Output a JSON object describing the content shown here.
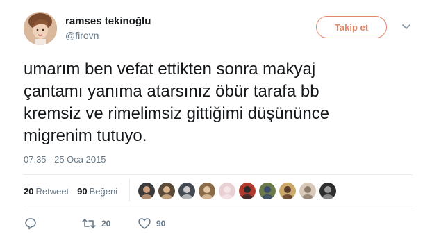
{
  "user": {
    "display_name": "ramses tekinoğlu",
    "username": "@firovn"
  },
  "follow_button_label": "Takip et",
  "tweet": {
    "lines": [
      "umarım ben vefat ettikten sonra makyaj",
      "çantamı yanıma atarsınız öbür tarafa bb",
      "kremsiz ve rimelimsiz gittiğimi düşününce",
      "migrenim tutuyo."
    ],
    "timestamp": "07:35 - 25 Oca 2015"
  },
  "stats": {
    "retweet_count": "20",
    "retweet_label": "Retweet",
    "like_count": "90",
    "like_label": "Beğeni"
  },
  "likers": [
    {
      "color": "#3b3b3b",
      "accent": "#cfa07d"
    },
    {
      "color": "#5a4a3a",
      "accent": "#d9b48c"
    },
    {
      "color": "#444a52",
      "accent": "#cfcfcf"
    },
    {
      "color": "#8a6c4a",
      "accent": "#e3c7a3"
    },
    {
      "color": "#e8d0d4",
      "accent": "#f5e6e8"
    },
    {
      "color": "#b03a2e",
      "accent": "#2a2a2a"
    },
    {
      "color": "#6b7a4a",
      "accent": "#3a4a6a"
    },
    {
      "color": "#c9a86a",
      "accent": "#5a3a2a"
    },
    {
      "color": "#d8c8b8",
      "accent": "#8a7a6a"
    },
    {
      "color": "#2e2e2e",
      "accent": "#9a9a9a"
    }
  ],
  "actions": {
    "retweet_count": "20",
    "like_count": "90"
  },
  "colors": {
    "accent": "#e0876a",
    "secondary_text": "#657786",
    "divider": "#e6ecf0"
  }
}
